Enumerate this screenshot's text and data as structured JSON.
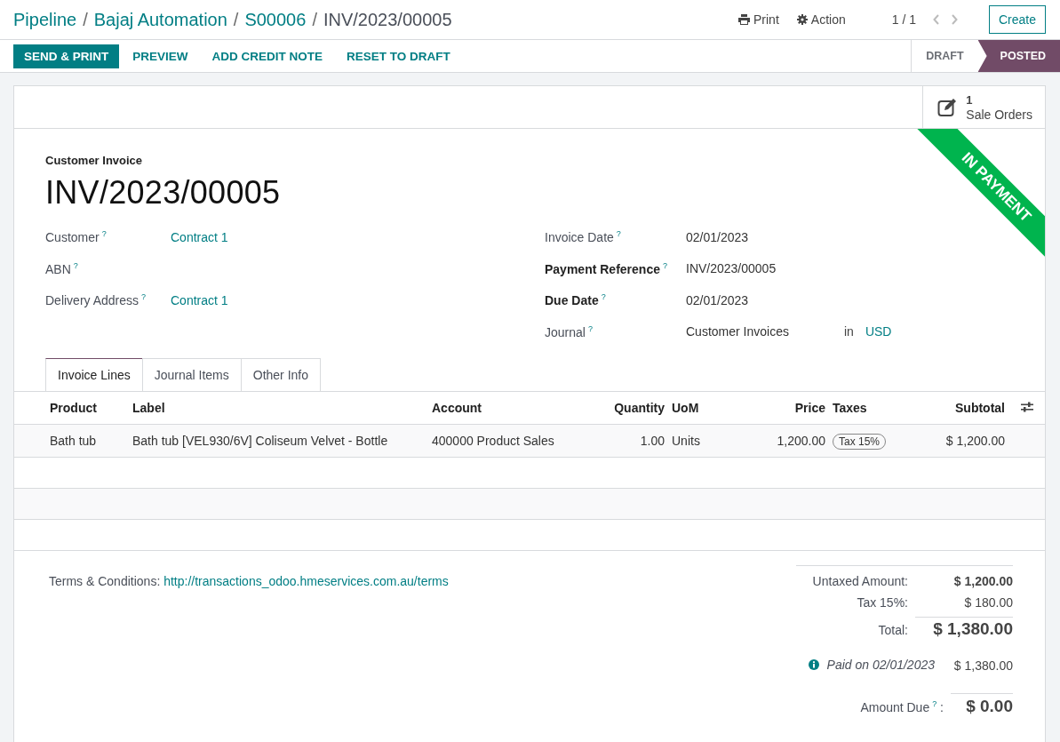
{
  "breadcrumbs": [
    {
      "label": "Pipeline",
      "current": false
    },
    {
      "label": "Bajaj Automation",
      "current": false
    },
    {
      "label": "S00006",
      "current": false
    },
    {
      "label": "INV/2023/00005",
      "current": true
    }
  ],
  "breadcrumb_separator": "/",
  "toolbar": {
    "print": "Print",
    "action": "Action",
    "pager": "1 / 1",
    "create": "Create"
  },
  "actions": [
    {
      "label": "SEND & PRINT",
      "kind": "primary"
    },
    {
      "label": "PREVIEW",
      "kind": "link"
    },
    {
      "label": "ADD CREDIT NOTE",
      "kind": "link"
    },
    {
      "label": "RESET TO DRAFT",
      "kind": "link"
    }
  ],
  "status_steps": [
    {
      "label": "DRAFT",
      "selected": false
    },
    {
      "label": "POSTED",
      "selected": true
    }
  ],
  "smart_button": {
    "count": "1",
    "label": "Sale Orders"
  },
  "ribbon": "IN PAYMENT",
  "document_type": "Customer Invoice",
  "document_name": "INV/2023/00005",
  "left_fields": [
    {
      "label": "Customer",
      "help": "?",
      "required": false,
      "value": "Contract 1",
      "kind": "link"
    },
    {
      "label": "ABN",
      "help": "?",
      "required": false,
      "kind": "empty"
    },
    {
      "label": "Delivery Address",
      "help": "?",
      "required": false,
      "value": "Contract 1",
      "kind": "link"
    }
  ],
  "right_fields": [
    {
      "label": "Invoice Date",
      "help": "?",
      "required": false,
      "value": "02/01/2023",
      "kind": "text"
    },
    {
      "label": "Payment Reference",
      "help": "?",
      "required": true,
      "value": "INV/2023/00005",
      "kind": "text"
    },
    {
      "label": "Due Date",
      "help": "?",
      "required": true,
      "value": "02/01/2023",
      "kind": "text"
    },
    {
      "label": "Journal",
      "help": "?",
      "required": false,
      "value": "Customer Invoices",
      "connector": "in",
      "currency": "USD",
      "kind": "journal"
    }
  ],
  "tabs": [
    {
      "label": "Invoice Lines",
      "selected": true
    },
    {
      "label": "Journal Items",
      "selected": false
    },
    {
      "label": "Other Info",
      "selected": false
    }
  ],
  "table": {
    "columns": [
      {
        "label": "Product",
        "numeric": false
      },
      {
        "label": "Label",
        "numeric": false
      },
      {
        "label": "Account",
        "numeric": false
      },
      {
        "label": "Quantity",
        "numeric": true
      },
      {
        "label": "UoM",
        "numeric": false
      },
      {
        "label": "Price",
        "numeric": true
      },
      {
        "label": "Taxes",
        "numeric": false
      },
      {
        "label": "Subtotal",
        "numeric": true
      }
    ],
    "rows": [
      {
        "cells": [
          "Bath tub",
          "Bath tub [VEL930/6V] Coliseum Velvet - Bottle",
          "400000 Product Sales",
          "1.00",
          "Units",
          "1,200.00",
          "Tax 15%",
          "$ 1,200.00"
        ]
      }
    ]
  },
  "terms": {
    "label": "Terms & Conditions:",
    "link": "http://transactions_odoo.hmeservices.com.au/terms"
  },
  "totals": [
    {
      "label": "Untaxed Amount:",
      "value": "$ 1,200.00",
      "kind": "bold"
    },
    {
      "label": "Tax 15%:",
      "value": "$ 180.00",
      "kind": "normal"
    },
    {
      "label": "Total:",
      "value": "$ 1,380.00",
      "kind": "total"
    }
  ],
  "payment": {
    "label": "Paid on 02/01/2023",
    "value": "$ 1,380.00"
  },
  "amount_due": {
    "label": "Amount Due",
    "help": "?",
    "suffix": ":",
    "value": "$ 0.00"
  }
}
